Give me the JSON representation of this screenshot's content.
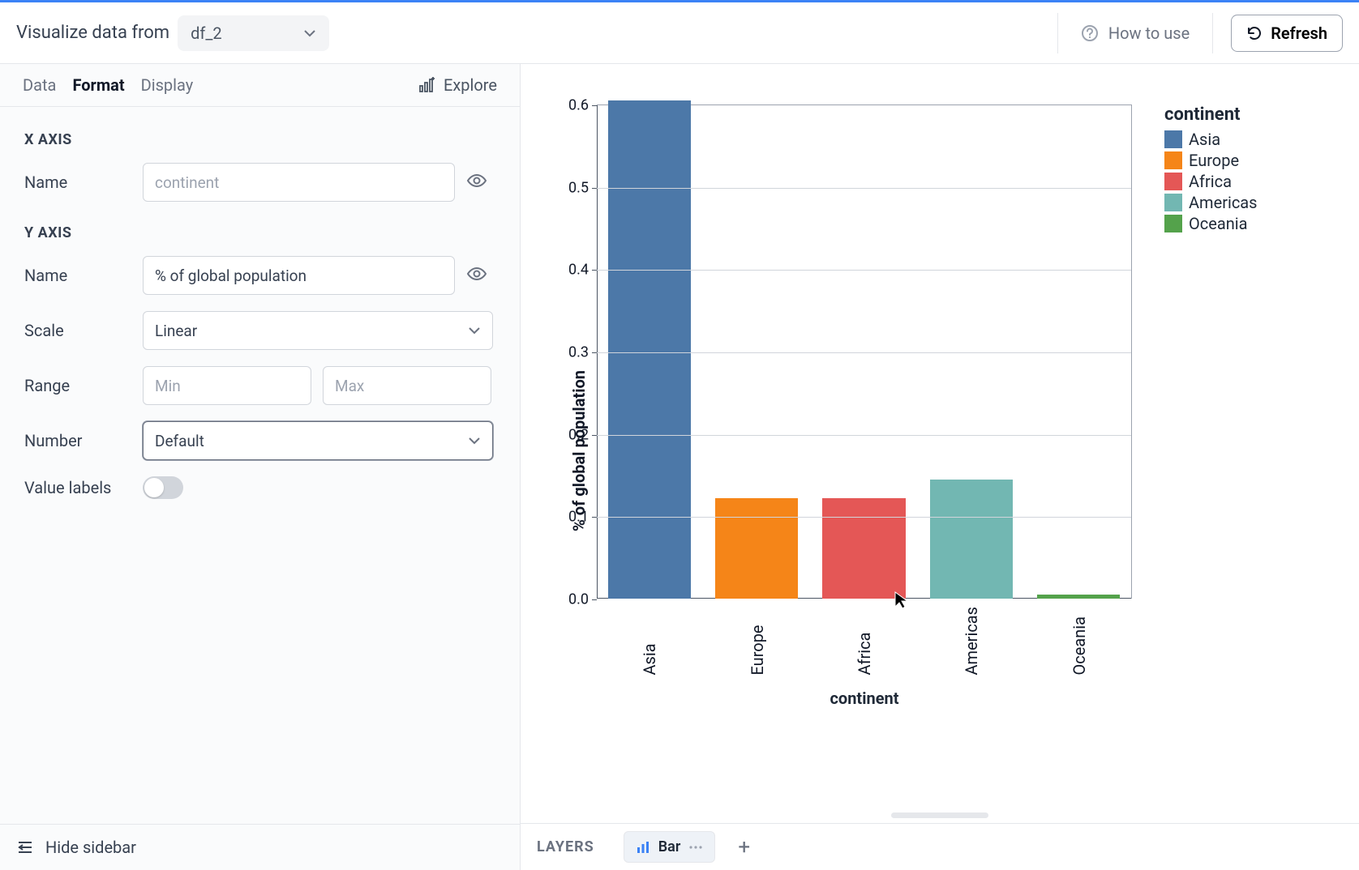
{
  "topbar": {
    "title": "Visualize data from",
    "dataframe": "df_2",
    "howto": "How to use",
    "refresh": "Refresh"
  },
  "tabs": {
    "data": "Data",
    "format": "Format",
    "display": "Display",
    "explore": "Explore"
  },
  "xaxis": {
    "header": "X AXIS",
    "name_label": "Name",
    "name_placeholder": "continent"
  },
  "yaxis": {
    "header": "Y AXIS",
    "name_label": "Name",
    "name_value": "% of global population",
    "scale_label": "Scale",
    "scale_value": "Linear",
    "range_label": "Range",
    "range_min_placeholder": "Min",
    "range_max_placeholder": "Max",
    "number_label": "Number",
    "number_value": "Default",
    "valuelabels_label": "Value labels"
  },
  "sidebar_footer": "Hide sidebar",
  "layers": {
    "label": "LAYERS",
    "chip": "Bar"
  },
  "chart_data": {
    "type": "bar",
    "xlabel": "continent",
    "ylabel": "% of global population",
    "legend_title": "continent",
    "ylim": [
      0.0,
      0.6
    ],
    "yticks": [
      "0.0",
      "0.1",
      "0.2",
      "0.3",
      "0.4",
      "0.5",
      "0.6"
    ],
    "categories": [
      "Asia",
      "Europe",
      "Africa",
      "Americas",
      "Oceania"
    ],
    "values": [
      0.605,
      0.122,
      0.122,
      0.145,
      0.005
    ],
    "colors": [
      "#4c78a8",
      "#f58518",
      "#e45756",
      "#72b7b2",
      "#54a24b"
    ]
  }
}
